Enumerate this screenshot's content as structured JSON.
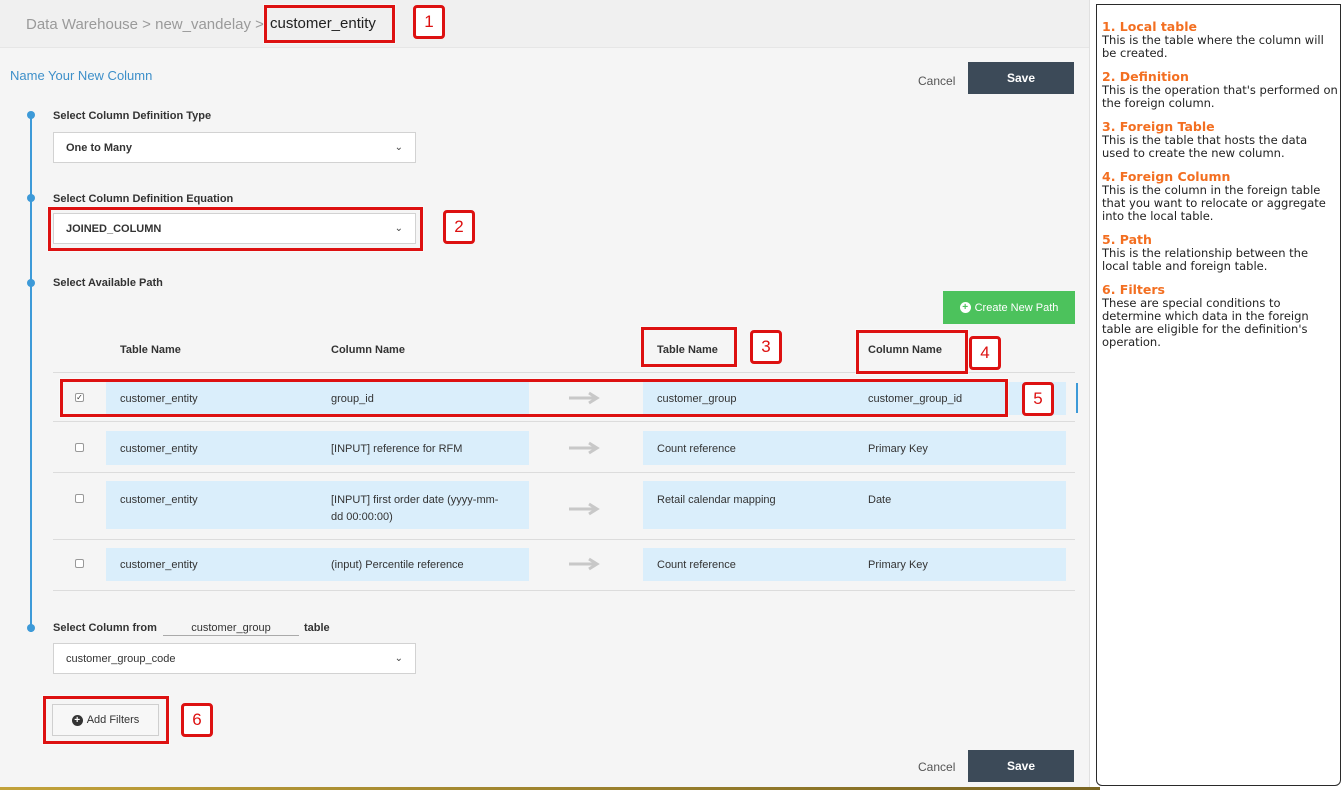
{
  "breadcrumb": {
    "path": "Data Warehouse > new_vandelay > ",
    "current": "customer_entity"
  },
  "header": {
    "section_title": "Name Your New Column",
    "cancel_label": "Cancel",
    "save_label": "Save"
  },
  "steps": {
    "definition_type": {
      "label": "Select Column Definition Type",
      "value": "One to Many"
    },
    "definition_equation": {
      "label": "Select Column Definition Equation",
      "value": "JOINED_COLUMN"
    },
    "available_path": {
      "label": "Select Available Path",
      "create_path_label": "Create New Path"
    },
    "select_column": {
      "label_prefix": "Select Column from",
      "table": "customer_group",
      "label_suffix": "table",
      "value": "customer_group_code"
    }
  },
  "path_table": {
    "headers": {
      "local_table": "Table Name",
      "local_column": "Column Name",
      "foreign_table": "Table Name",
      "foreign_column": "Column Name"
    },
    "rows": [
      {
        "checked": true,
        "local_table": "customer_entity",
        "local_column": "group_id",
        "foreign_table": "customer_group",
        "foreign_column": "customer_group_id"
      },
      {
        "checked": false,
        "local_table": "customer_entity",
        "local_column": "[INPUT] reference for RFM",
        "foreign_table": "Count reference",
        "foreign_column": "Primary Key"
      },
      {
        "checked": false,
        "local_table": "customer_entity",
        "local_column_line1": "[INPUT] first order date (yyyy-mm-",
        "local_column_line2": "dd 00:00:00)",
        "foreign_table": "Retail calendar mapping",
        "foreign_column": "Date"
      },
      {
        "checked": false,
        "local_table": "customer_entity",
        "local_column": "(input) Percentile reference",
        "foreign_table": "Count reference",
        "foreign_column": "Primary Key"
      }
    ]
  },
  "filters": {
    "add_label": "Add Filters"
  },
  "footer": {
    "cancel_label": "Cancel",
    "save_label": "Save"
  },
  "annotations": [
    "1",
    "2",
    "3",
    "4",
    "5",
    "6"
  ],
  "help": [
    {
      "title": "1. Local table",
      "body": "This is the table where the column will be created."
    },
    {
      "title": "2. Definition",
      "body": "This is the operation that's performed on the foreign column."
    },
    {
      "title": "3. Foreign Table",
      "body": "This is the table that hosts the data used to create the new column."
    },
    {
      "title": "4. Foreign Column",
      "body": "This is the column in the foreign table that you want to relocate or aggregate into the local table."
    },
    {
      "title": "5. Path",
      "body": "This is the relationship between the local table and foreign table."
    },
    {
      "title": "6. Filters",
      "body": "These are special conditions to determine which data in the foreign table are eligible for the definition's operation."
    }
  ],
  "colors": {
    "accent_blue": "#3d9ad8",
    "save_button": "#3c4a58",
    "create_button": "#4cc25c",
    "row_highlight": "#daeefb",
    "annotation_red": "#dd1111",
    "help_title_orange": "#f36f21"
  }
}
